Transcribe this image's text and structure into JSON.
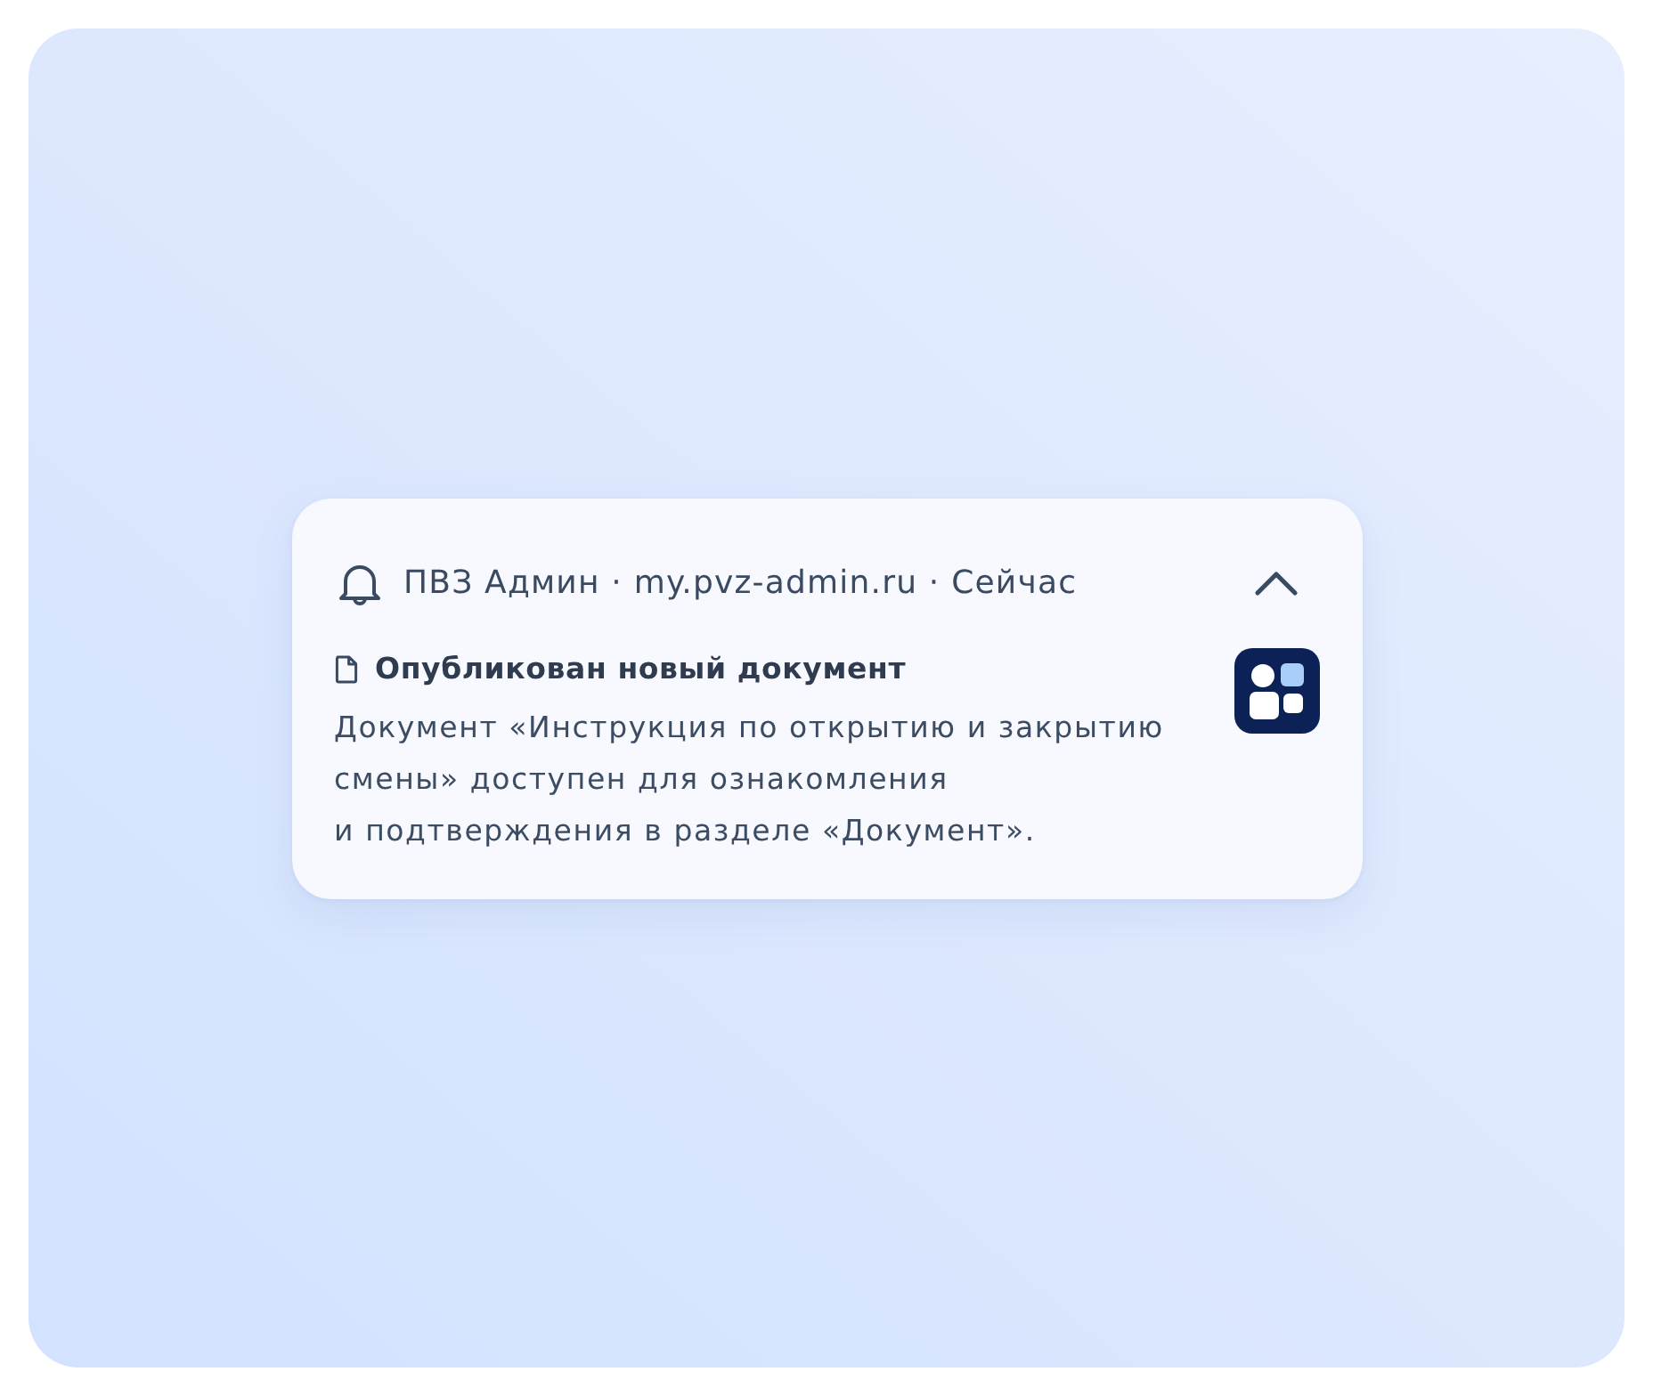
{
  "notification": {
    "header": "ПВЗ Админ · my.pvz-admin.ru · Сейчас",
    "expanded": true,
    "title": "Опубликован новый документ",
    "body": "Документ «Инструкция по открытию и закрытию\nсмены» доступен для ознакомления\nи подтверждения в разделе «Документ»."
  }
}
